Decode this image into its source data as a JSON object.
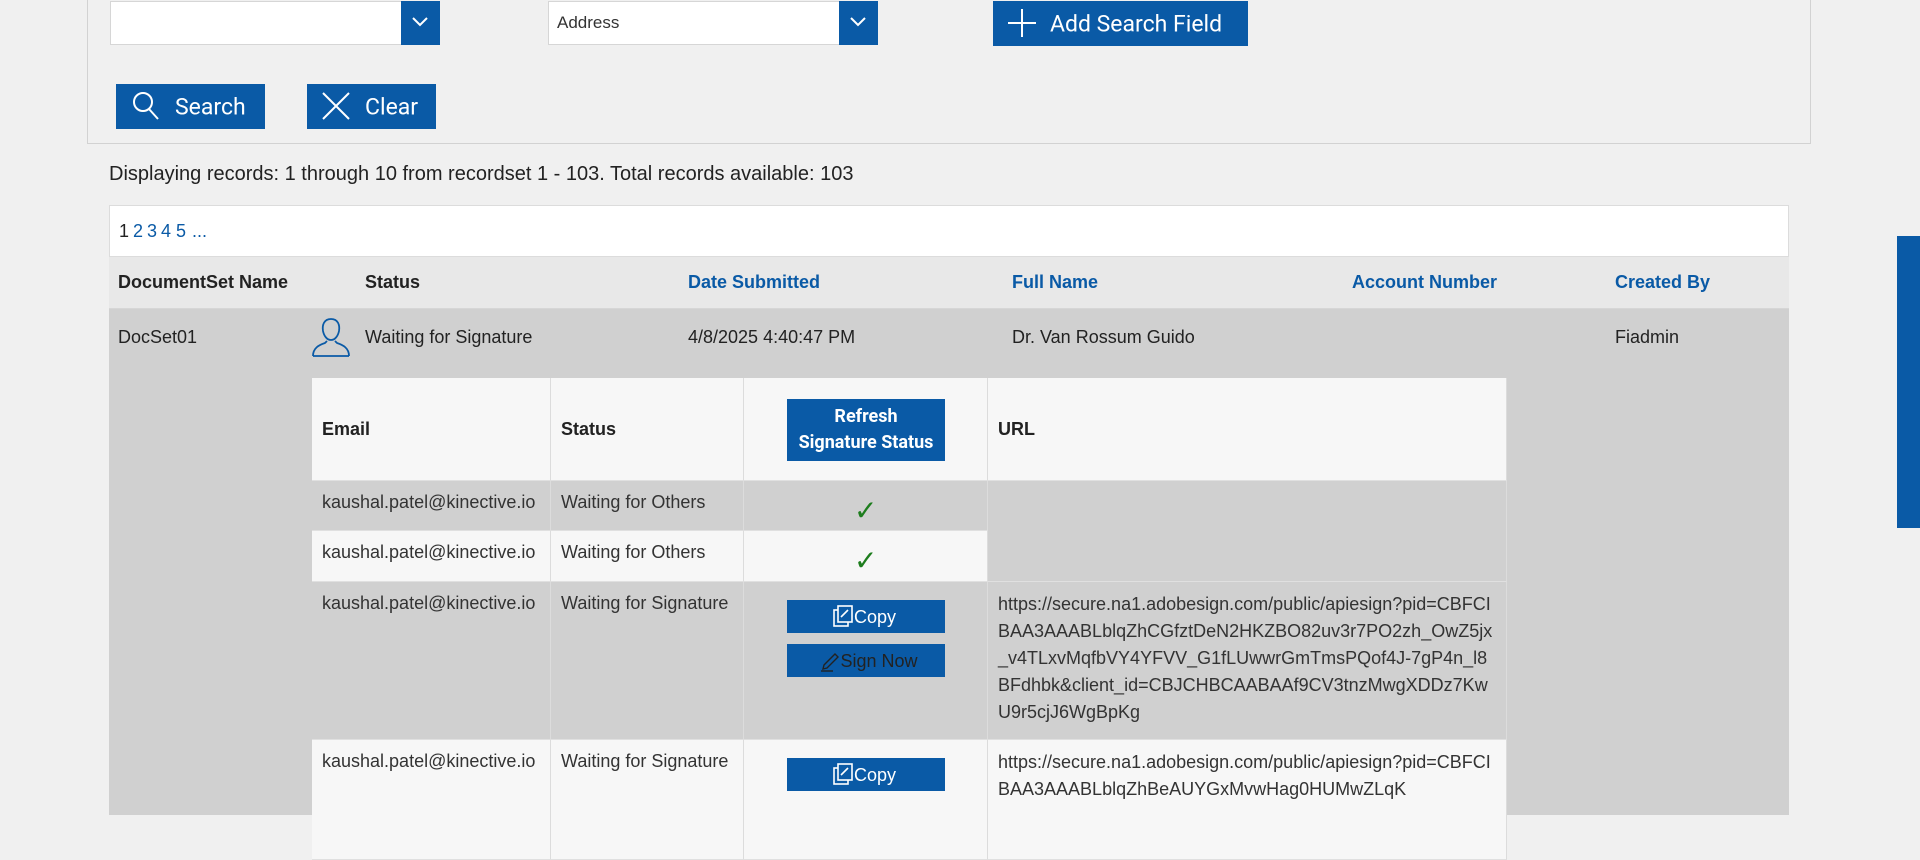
{
  "search": {
    "field1": {
      "value": ""
    },
    "field2": {
      "value": "Address"
    },
    "add_field_label": "Add Search Field",
    "search_label": "Search",
    "clear_label": "Clear"
  },
  "summary_text": "Displaying records: 1 through 10 from recordset 1 - 103. Total records available: 103",
  "pager": {
    "pages": [
      "1",
      "2",
      "3",
      "4",
      "5",
      "..."
    ],
    "current": "1"
  },
  "columns": [
    "DocumentSet Name",
    "Status",
    "Date Submitted",
    "Full Name",
    "Account Number",
    "Created By"
  ],
  "record": {
    "name": "DocSet01",
    "status": "Waiting for Signature",
    "date_submitted": "4/8/2025 4:40:47 PM",
    "full_name": "Dr. Van Rossum Guido",
    "account_number": "",
    "created_by": "Fiadmin"
  },
  "signers": {
    "headers": {
      "email": "Email",
      "status": "Status",
      "refresh_line1": "Refresh",
      "refresh_line2": "Signature Status",
      "url": "URL"
    },
    "rows": [
      {
        "email": "kaushal.patel@kinective.io",
        "status": "Waiting for Others",
        "check": "✓"
      },
      {
        "email": "kaushal.patel@kinective.io",
        "status": "Waiting for Others",
        "check": "✓"
      },
      {
        "email": "kaushal.patel@kinective.io",
        "status": "Waiting for Signature",
        "copy_label": "Copy",
        "sign_label": "Sign Now",
        "url": "https://secure.na1.adobesign.com/public/apiesign?pid=CBFCIBAA3AAABLblqZhCGfztDeN2HKZBO82uv3r7PO2zh_OwZ5jx_v4TLxvMqfbVY4YFVV_G1fLUwwrGmTmsPQof4J-7gP4n_l8BFdhbk&client_id=CBJCHBCAABAAf9CV3tnzMwgXDDz7KwU9r5cjJ6WgBpKg"
      },
      {
        "email": "kaushal.patel@kinective.io",
        "status": "Waiting for Signature",
        "copy_label": "Copy",
        "url": "https://secure.na1.adobesign.com/public/apiesign?pid=CBFCIBAA3AAABLblqZhBeAUYGxMvwHag0HUMwZLqK"
      }
    ]
  }
}
